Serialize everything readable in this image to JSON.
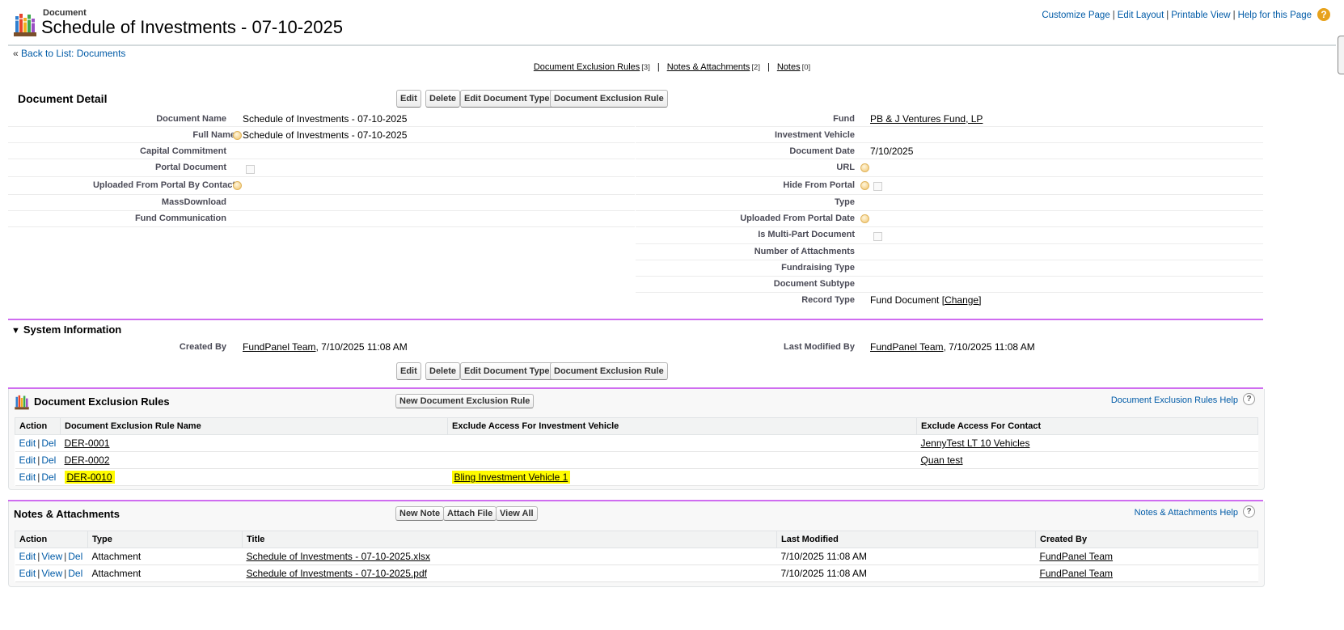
{
  "header": {
    "object_type": "Document",
    "title": "Schedule of Investments - 07-10-2025",
    "links": [
      "Customize Page",
      "Edit Layout",
      "Printable View",
      "Help for this Page"
    ]
  },
  "back_link": {
    "prefix": "«",
    "label": "Back to List: Documents"
  },
  "related_links": [
    {
      "label": "Document Exclusion Rules",
      "count": "[3]"
    },
    {
      "label": "Notes & Attachments",
      "count": "[2]"
    },
    {
      "label": "Notes",
      "count": "[0]"
    }
  ],
  "detail": {
    "title": "Document Detail",
    "buttons": [
      "Edit",
      "Delete",
      "Edit Document Type",
      "Document Exclusion Rule"
    ],
    "left_fields": [
      {
        "label": "Document Name",
        "value": "Schedule of Investments - 07-10-2025"
      },
      {
        "label": "Full Name",
        "value": "Schedule of Investments - 07-10-2025"
      },
      {
        "label": "Capital Commitment",
        "value": ""
      },
      {
        "label": "Portal Document",
        "value": ""
      },
      {
        "label": "Uploaded From Portal By Contact",
        "value": ""
      },
      {
        "label": "MassDownload",
        "value": ""
      },
      {
        "label": "Fund Communication",
        "value": ""
      }
    ],
    "right_fields": [
      {
        "label": "Fund",
        "value": "PB & J Ventures Fund, LP"
      },
      {
        "label": "Investment Vehicle",
        "value": ""
      },
      {
        "label": "Document Date",
        "value": "7/10/2025"
      },
      {
        "label": "URL",
        "value": ""
      },
      {
        "label": "Hide From Portal",
        "value": ""
      },
      {
        "label": "Type",
        "value": ""
      },
      {
        "label": "Uploaded From Portal Date",
        "value": ""
      },
      {
        "label": "Is Multi-Part Document",
        "value": ""
      },
      {
        "label": "Number of Attachments",
        "value": ""
      },
      {
        "label": "Fundraising Type",
        "value": ""
      },
      {
        "label": "Document Subtype",
        "value": ""
      },
      {
        "label": "Record Type",
        "value": "Fund Document",
        "change": "[Change]"
      }
    ]
  },
  "system_info": {
    "title": "System Information",
    "created_by_label": "Created By",
    "created_by_user": "FundPanel Team",
    "created_by_date": ", 7/10/2025 11:08 AM",
    "modified_by_label": "Last Modified By",
    "modified_by_user": "FundPanel Team",
    "modified_by_date": ", 7/10/2025 11:08 AM"
  },
  "exclusion_rules": {
    "title": "Document Exclusion Rules",
    "new_button": "New Document Exclusion Rule",
    "help": "Document Exclusion Rules Help",
    "columns": [
      "Action",
      "Document Exclusion Rule Name",
      "Exclude Access For Investment Vehicle",
      "Exclude Access For Contact"
    ],
    "action_edit": "Edit",
    "action_del": "Del",
    "rows": [
      {
        "name": "DER-0001",
        "vehicle": "",
        "contact": "JennyTest LT 10 Vehicles"
      },
      {
        "name": "DER-0002",
        "vehicle": "",
        "contact": "Quan test"
      },
      {
        "name": "DER-0010",
        "vehicle": "Bling Investment Vehicle 1",
        "contact": ""
      }
    ]
  },
  "notes_attachments": {
    "title": "Notes & Attachments",
    "buttons": [
      "New Note",
      "Attach File",
      "View All"
    ],
    "help": "Notes & Attachments Help",
    "columns": [
      "Action",
      "Type",
      "Title",
      "Last Modified",
      "Created By"
    ],
    "action_edit": "Edit",
    "action_view": "View",
    "action_del": "Del",
    "rows": [
      {
        "type": "Attachment",
        "title": "Schedule of Investments - 07-10-2025.xlsx",
        "modified": "7/10/2025 11:08 AM",
        "created_by": "FundPanel Team"
      },
      {
        "type": "Attachment",
        "title": "Schedule of Investments - 07-10-2025.pdf",
        "modified": "7/10/2025 11:08 AM",
        "created_by": "FundPanel Team"
      }
    ]
  },
  "colors": {
    "link": "#015ba7",
    "section_border": "#cf6df0",
    "highlight": "#fffb00"
  }
}
